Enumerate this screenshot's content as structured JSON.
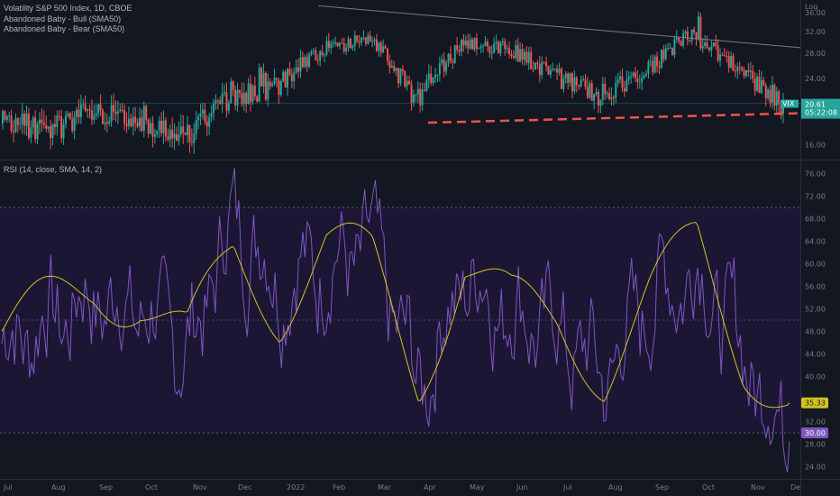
{
  "header": {
    "symbol_line": "Volatility S&P 500 Index, 1D, CBOE",
    "indicator1": "Abandoned Baby - Bull (SMA50)",
    "indicator2": "Abandoned Baby - Bear (SMA50)",
    "rsi_label": "RSI (14, close, SMA, 14, 2)"
  },
  "price_pane": {
    "scale_label": "Log",
    "yticks": [
      "36.00",
      "32.00",
      "28.00",
      "24.00",
      "16.00"
    ],
    "price_badge": {
      "ticker": "VIX",
      "value": "20.61",
      "countdown": "05:22:08"
    }
  },
  "rsi_pane": {
    "yticks": [
      "76.00",
      "72.00",
      "68.00",
      "64.00",
      "60.00",
      "56.00",
      "52.00",
      "48.00",
      "44.00",
      "40.00",
      "32.00",
      "28.00",
      "24.00"
    ],
    "rsi_value": "30.00",
    "ma_value": "35.33",
    "upper_band": 70,
    "lower_band": 30,
    "mid_line": 50
  },
  "xaxis": {
    "labels": [
      "Jul",
      "Aug",
      "Sep",
      "Oct",
      "Nov",
      "Dec",
      "2022",
      "Feb",
      "Mar",
      "Apr",
      "May",
      "Jun",
      "Jul",
      "Aug",
      "Sep",
      "Oct",
      "Nov",
      "De"
    ]
  },
  "colors": {
    "up": "#26a69a",
    "down": "#ef5350",
    "rsi_line": "#7e57c2",
    "rsi_ma": "#d4c21f",
    "trendline": "#787b86",
    "support": "#ef5350",
    "band_fill": "#1c1635"
  },
  "chart_data": [
    {
      "type": "candlestick",
      "title": "Volatility S&P 500 Index, 1D, CBOE",
      "x": [
        "2021-07",
        "2021-08",
        "2021-09",
        "2021-10",
        "2021-11",
        "2021-12",
        "2022-01",
        "2022-02",
        "2022-03",
        "2022-04",
        "2022-05",
        "2022-06",
        "2022-07",
        "2022-08",
        "2022-09",
        "2022-10",
        "2022-11",
        "2022-12"
      ],
      "close_monthly_approx": [
        18.2,
        17.5,
        19.8,
        18.0,
        16.9,
        21.5,
        23.0,
        29.0,
        30.5,
        21.0,
        29.5,
        29.0,
        24.5,
        21.5,
        25.0,
        31.5,
        25.5,
        20.61
      ],
      "last": 20.61,
      "ylim": [
        15,
        38
      ],
      "scale": "log"
    },
    {
      "type": "line",
      "title": "RSI (14, close, SMA, 14, 2)",
      "series": [
        {
          "name": "RSI",
          "values_monthly_approx": [
            46,
            50,
            54,
            52,
            44,
            68,
            58,
            60,
            62,
            38,
            58,
            52,
            48,
            40,
            54,
            60,
            44,
            30.0
          ]
        },
        {
          "name": "RSI-based MA",
          "values_monthly_approx": [
            48,
            52,
            56,
            54,
            46,
            62,
            52,
            63,
            60,
            40,
            60,
            52,
            50,
            41,
            54,
            64,
            44,
            35.33
          ]
        }
      ],
      "ylim": [
        22,
        78
      ],
      "bands": [
        30,
        50,
        70
      ]
    }
  ]
}
